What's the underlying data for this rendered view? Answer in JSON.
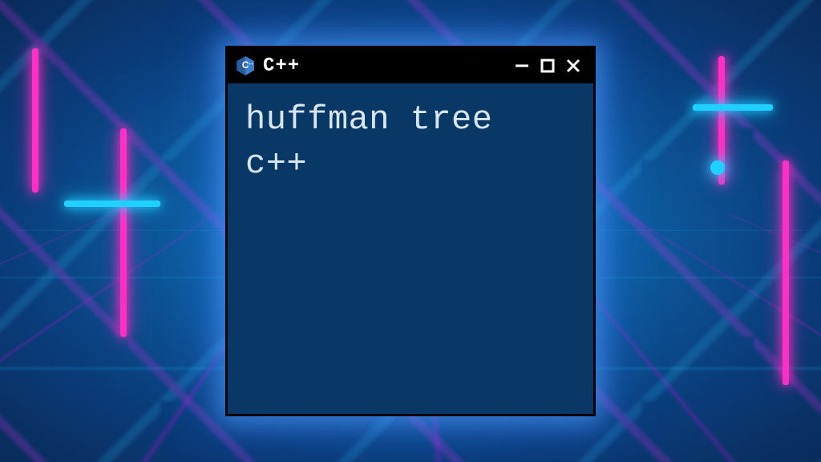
{
  "window": {
    "title": "C++",
    "icons": {
      "app": "cpp-logo-icon",
      "minimize": "minimize-icon",
      "maximize": "maximize-icon",
      "close": "close-icon"
    }
  },
  "content": {
    "line1": "huffman tree",
    "line2": "c++"
  },
  "colors": {
    "titlebar_bg": "#000000",
    "window_bg": "#0a3866",
    "text": "#d8e6f2",
    "glow": "#3fa0ff"
  }
}
